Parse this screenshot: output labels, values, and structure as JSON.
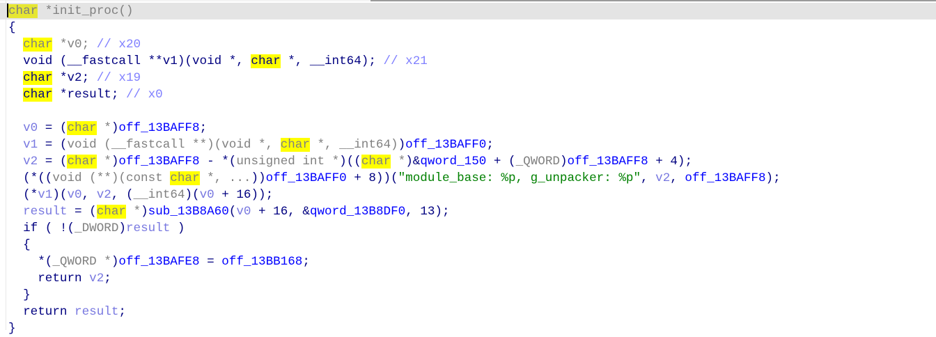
{
  "colors": {
    "keyword": "#000080",
    "type": "#808080",
    "global": "#0000ff",
    "variable": "#7878e0",
    "comment": "#8080ff",
    "string": "#008000",
    "highlight": "#ffff00"
  },
  "lines": [
    [
      [
        "hlc",
        "char"
      ],
      [
        "g",
        " *init_proc()"
      ]
    ],
    [
      [
        "k",
        "{"
      ]
    ],
    [
      [
        "k",
        "  "
      ],
      [
        "hlg",
        "char"
      ],
      [
        "g",
        " *v0; "
      ],
      [
        "c",
        "// x20"
      ]
    ],
    [
      [
        "k",
        "  void (__fastcall **v1)(void *, "
      ],
      [
        "hl",
        "char"
      ],
      [
        "k",
        " *, __int64); "
      ],
      [
        "c",
        "// x21"
      ]
    ],
    [
      [
        "k",
        "  "
      ],
      [
        "hl",
        "char"
      ],
      [
        "k",
        " *v2; "
      ],
      [
        "c",
        "// x19"
      ]
    ],
    [
      [
        "k",
        "  "
      ],
      [
        "hl",
        "char"
      ],
      [
        "k",
        " *result; "
      ],
      [
        "c",
        "// x0"
      ]
    ],
    [],
    [
      [
        "k",
        "  "
      ],
      [
        "v",
        "v0"
      ],
      [
        "k",
        " = ("
      ],
      [
        "hlg",
        "char"
      ],
      [
        "g",
        " *"
      ],
      [
        "k",
        ")"
      ],
      [
        "b",
        "off_13BAFF8"
      ],
      [
        "k",
        ";"
      ]
    ],
    [
      [
        "k",
        "  "
      ],
      [
        "v",
        "v1"
      ],
      [
        "k",
        " = ("
      ],
      [
        "g",
        "void (__fastcall **)(void *, "
      ],
      [
        "hlg",
        "char"
      ],
      [
        "g",
        " *, __int64)"
      ],
      [
        "k",
        ")"
      ],
      [
        "b",
        "off_13BAFF0"
      ],
      [
        "k",
        ";"
      ]
    ],
    [
      [
        "k",
        "  "
      ],
      [
        "v",
        "v2"
      ],
      [
        "k",
        " = ("
      ],
      [
        "hlg",
        "char"
      ],
      [
        "g",
        " *"
      ],
      [
        "k",
        ")"
      ],
      [
        "b",
        "off_13BAFF8"
      ],
      [
        "k",
        " - *("
      ],
      [
        "g",
        "unsigned int *"
      ],
      [
        "k",
        ")(("
      ],
      [
        "hlg",
        "char"
      ],
      [
        "g",
        " *"
      ],
      [
        "k",
        ")&"
      ],
      [
        "b",
        "qword_150"
      ],
      [
        "k",
        " + ("
      ],
      [
        "g",
        "_QWORD"
      ],
      [
        "k",
        ")"
      ],
      [
        "b",
        "off_13BAFF8"
      ],
      [
        "k",
        " + 4);"
      ]
    ],
    [
      [
        "k",
        "  (*(("
      ],
      [
        "g",
        "void (**)(const "
      ],
      [
        "hlg",
        "char"
      ],
      [
        "g",
        " *, ..."
      ],
      [
        "k",
        "))"
      ],
      [
        "b",
        "off_13BAFF0"
      ],
      [
        "k",
        " + 8))("
      ],
      [
        "s",
        "\"module_base: %p, g_unpacker: %p\""
      ],
      [
        "k",
        ", "
      ],
      [
        "v",
        "v2"
      ],
      [
        "k",
        ", "
      ],
      [
        "b",
        "off_13BAFF8"
      ],
      [
        "k",
        ");"
      ]
    ],
    [
      [
        "k",
        "  (*"
      ],
      [
        "v",
        "v1"
      ],
      [
        "k",
        ")("
      ],
      [
        "v",
        "v0"
      ],
      [
        "k",
        ", "
      ],
      [
        "v",
        "v2"
      ],
      [
        "k",
        ", ("
      ],
      [
        "g",
        "__int64"
      ],
      [
        "k",
        ")("
      ],
      [
        "v",
        "v0"
      ],
      [
        "k",
        " + 16));"
      ]
    ],
    [
      [
        "k",
        "  "
      ],
      [
        "v",
        "result"
      ],
      [
        "k",
        " = ("
      ],
      [
        "hlg",
        "char"
      ],
      [
        "g",
        " *"
      ],
      [
        "k",
        ")"
      ],
      [
        "b",
        "sub_13B8A60"
      ],
      [
        "k",
        "("
      ],
      [
        "v",
        "v0"
      ],
      [
        "k",
        " + 16, &"
      ],
      [
        "b",
        "qword_13B8DF0"
      ],
      [
        "k",
        ", 13);"
      ]
    ],
    [
      [
        "k",
        "  if ( !("
      ],
      [
        "g",
        "_DWORD"
      ],
      [
        "k",
        ")"
      ],
      [
        "v",
        "result"
      ],
      [
        "k",
        " )"
      ]
    ],
    [
      [
        "k",
        "  {"
      ]
    ],
    [
      [
        "k",
        "    *("
      ],
      [
        "g",
        "_QWORD *"
      ],
      [
        "k",
        ")"
      ],
      [
        "b",
        "off_13BAFE8"
      ],
      [
        "k",
        " = "
      ],
      [
        "b",
        "off_13BB168"
      ],
      [
        "k",
        ";"
      ]
    ],
    [
      [
        "k",
        "    return "
      ],
      [
        "v",
        "v2"
      ],
      [
        "k",
        ";"
      ]
    ],
    [
      [
        "k",
        "  }"
      ]
    ],
    [
      [
        "k",
        "  return "
      ],
      [
        "v",
        "result"
      ],
      [
        "k",
        ";"
      ]
    ],
    [
      [
        "k",
        "}"
      ]
    ]
  ]
}
